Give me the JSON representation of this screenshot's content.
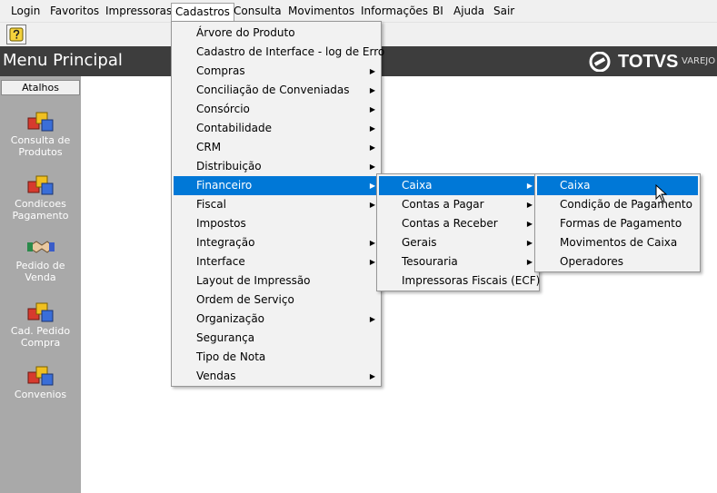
{
  "menubar": [
    "Login",
    "Favoritos",
    "Impressoras",
    "Cadastros",
    "Consulta",
    "Movimentos",
    "Informações",
    "BI",
    "Ajuda",
    "Sair"
  ],
  "header": {
    "title": "Menu Principal",
    "brand": "TOTVS",
    "brand_sub": "VAREJO"
  },
  "sidebar": {
    "tab": "Atalhos",
    "shortcuts": [
      {
        "line1": "Consulta de",
        "line2": "Produtos",
        "icon": "boxes-icon"
      },
      {
        "line1": "Condicoes",
        "line2": "Pagamento",
        "icon": "boxes-icon"
      },
      {
        "line1": "Pedido de",
        "line2": "Venda",
        "icon": "handshake-icon"
      },
      {
        "line1": "Cad. Pedido",
        "line2": "Compra",
        "icon": "boxes-icon"
      },
      {
        "line1": "Convenios",
        "line2": "",
        "icon": "boxes-icon"
      }
    ]
  },
  "cadastros_menu": [
    {
      "label": "Árvore do Produto",
      "submenu": false
    },
    {
      "label": "Cadastro de Interface - log de Erro",
      "submenu": false
    },
    {
      "label": "Compras",
      "submenu": true
    },
    {
      "label": "Conciliação de Conveniadas",
      "submenu": true
    },
    {
      "label": "Consórcio",
      "submenu": true
    },
    {
      "label": "Contabilidade",
      "submenu": true
    },
    {
      "label": "CRM",
      "submenu": true
    },
    {
      "label": "Distribuição",
      "submenu": true
    },
    {
      "label": "Financeiro",
      "submenu": true,
      "highlighted": true
    },
    {
      "label": "Fiscal",
      "submenu": true
    },
    {
      "label": "Impostos",
      "submenu": false
    },
    {
      "label": "Integração",
      "submenu": true
    },
    {
      "label": "Interface",
      "submenu": true
    },
    {
      "label": "Layout de Impressão",
      "submenu": false
    },
    {
      "label": "Ordem de Serviço",
      "submenu": false
    },
    {
      "label": "Organização",
      "submenu": true
    },
    {
      "label": "Segurança",
      "submenu": false
    },
    {
      "label": "Tipo de Nota",
      "submenu": false
    },
    {
      "label": "Vendas",
      "submenu": true
    }
  ],
  "financeiro_menu": [
    {
      "label": "Caixa",
      "submenu": true,
      "highlighted": true
    },
    {
      "label": "Contas a Pagar",
      "submenu": true
    },
    {
      "label": "Contas a Receber",
      "submenu": true
    },
    {
      "label": "Gerais",
      "submenu": true
    },
    {
      "label": "Tesouraria",
      "submenu": true
    },
    {
      "label": "Impressoras Fiscais (ECF)",
      "submenu": false
    }
  ],
  "caixa_menu": [
    {
      "label": "Caixa",
      "highlighted": true
    },
    {
      "label": "Condição de Pagamento"
    },
    {
      "label": "Formas de Pagamento"
    },
    {
      "label": "Movimentos de Caixa"
    },
    {
      "label": "Operadores"
    }
  ],
  "colors": {
    "highlight": "#0078d7",
    "header": "#3d3d3d",
    "sidebar": "#a9a9a9"
  }
}
